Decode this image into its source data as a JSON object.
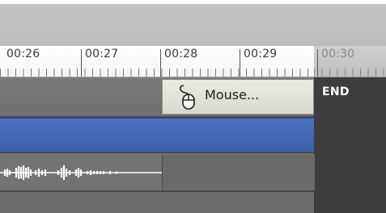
{
  "timeline": {
    "timecodes": [
      "00:26",
      "00:27",
      "00:28",
      "00:29",
      "00:30"
    ]
  },
  "clips": {
    "mouse_clip_label": "Mouse...",
    "end_label": "END"
  },
  "icons": {
    "mouse": "mouse-icon",
    "waveform": "audio-waveform-icon"
  },
  "colors": {
    "selected_track": "#4a6fbf",
    "end_zone": "#3d3d3d",
    "clip_background": "#e6e5dc",
    "track_background": "#737373"
  }
}
